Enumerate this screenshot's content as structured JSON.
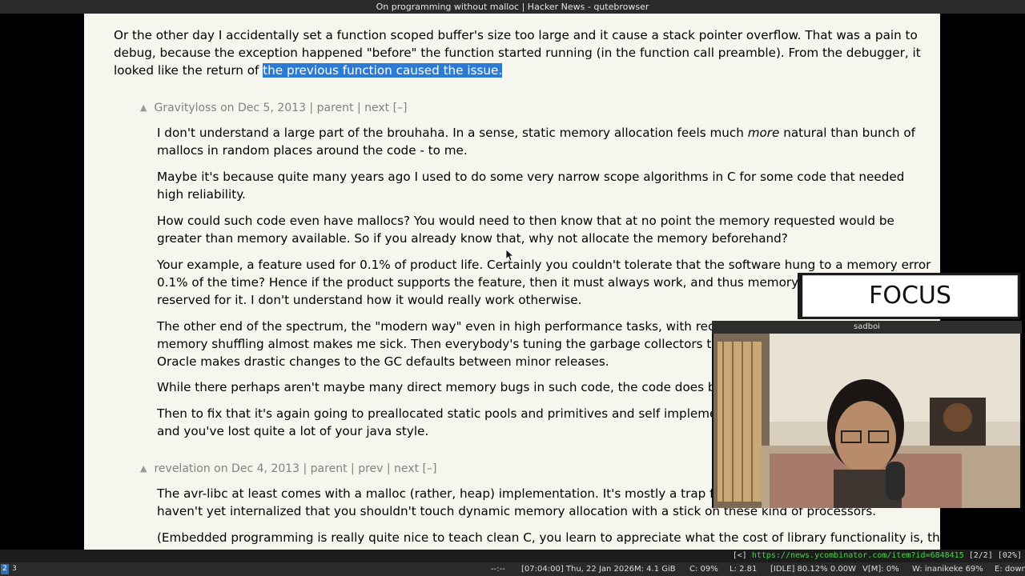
{
  "window": {
    "title": "On programming without malloc | Hacker News - qutebrowser"
  },
  "parent_comment": {
    "text_before": "Or the other day I accidentally set a function scoped buffer's size too large and it cause a stack pointer overflow. That was a pain to debug, because the exception happened \"before\" the function started running (in the function call preamble). From the debugger, it looked like the return of ",
    "highlighted": "the previous function caused the issue."
  },
  "comment1": {
    "user": "Gravityloss",
    "date": "on Dec 5, 2013",
    "links": [
      "parent",
      "next [–]"
    ],
    "paragraphs": {
      "p1_before": "I don't understand a large part of the brouhaha. In a sense, static memory allocation feels much ",
      "p1_em": "more",
      "p1_after": " natural than bunch of mallocs in random places around the code - to me.",
      "p2": "Maybe it's because quite many years ago I used to do some very narrow scope algorithms in C for some code that needed high reliability.",
      "p3": "How could such code even have mallocs? You would need to then know that at no point the memory requested would be greater than memory available. So if you already know that, why not allocate the memory beforehand?",
      "p4": "Your example, a feature used for 0.1% of product life. Certainly you couldn't tolerate that the software hung to a memory error 0.1% of the time? Hence if the product supports the feature, then it must always work, and thus memory m",
      "p4b": "reserved for it. I don't understand how it would really work otherwise.",
      "p5a": "The other end of the spectrum, the \"modern way\" even in high performance tasks, with reck",
      "p5b": "memory shuffling almost makes me sick. Then everybody's tuning the garbage collectors to",
      "p5c": "Oracle makes drastic changes to the GC defaults between minor releases.",
      "p6": "While there perhaps aren't maybe many direct memory bugs in such code, the code does be",
      "p7a": "Then to fix that it's again going to preallocated static pools and primitives and self implemen",
      "p7b": "and you've lost quite a lot of your java style."
    }
  },
  "comment2": {
    "user": "revelation",
    "date": "on Dec 4, 2013",
    "links": [
      "parent",
      "prev",
      "next [–]"
    ],
    "p1a": "The avr-libc at least comes with a malloc (rather, heap) implementation. It's mostly a trap for",
    "p1b": "haven't yet internalized that you shouldn't touch dynamic memory allocation with a stick on these kind of processors.",
    "p2": "(Embedded programming is really quite nice to teach clean C, you learn to appreciate what the cost of library functionality is, that"
  },
  "overlay": {
    "focus_label": "FOCUS",
    "cam_title": "sadboi"
  },
  "statusbar": {
    "back": "[<]",
    "url": "https://news.ycombinator.com/item?id=6848415",
    "tabs": "[2/2]",
    "scroll": "[02%]"
  },
  "taskbar": {
    "workspaces": [
      "2",
      "3"
    ],
    "sep": "--:--",
    "clock": "[07:04:00] Thu, 22 Jan 2026",
    "mem": "M: 4.1 GiB",
    "cpu": "C: 09%",
    "load": "L: 2.81",
    "idle": "[IDLE] 80.12% 0.00W",
    "vol": "V[M]: 0%",
    "wifi": "W: inanikeke  69%",
    "eth": "E: down"
  },
  "colors": {
    "page_bg": "#f6f6ef",
    "highlight": "#2b7bd6",
    "meta": "#828282",
    "url": "#4fd14f"
  }
}
